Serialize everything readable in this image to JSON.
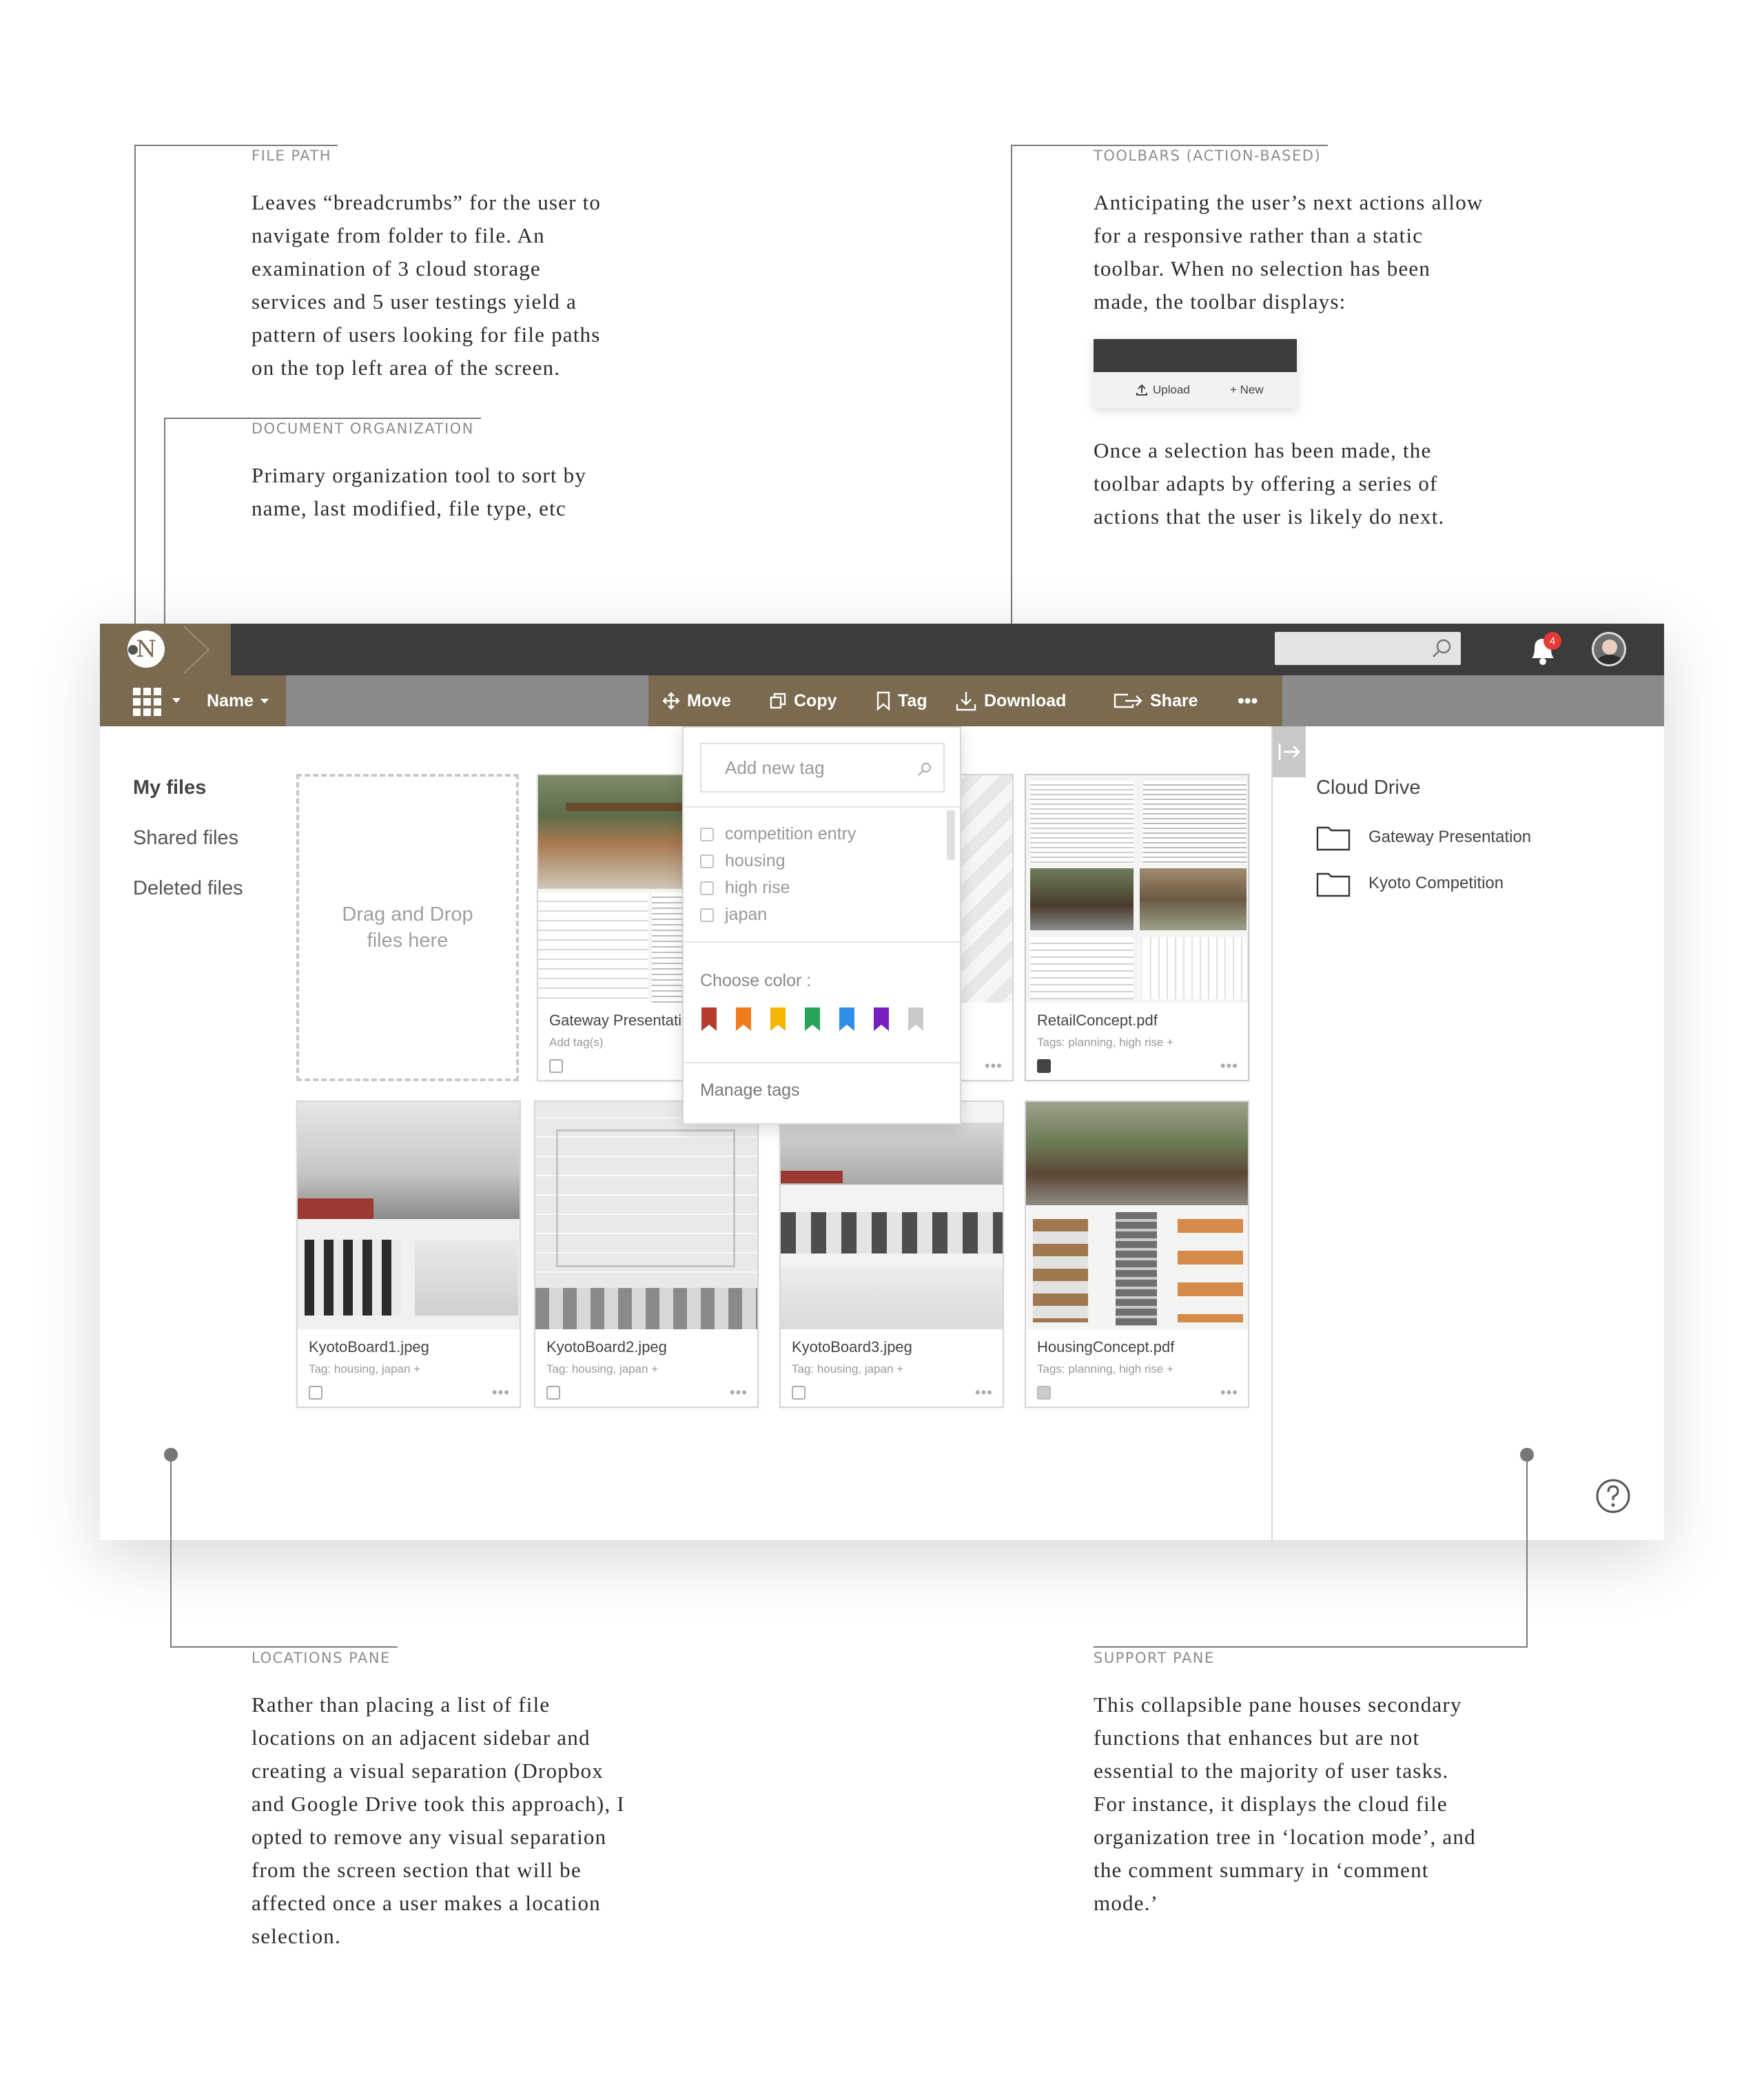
{
  "annotations": {
    "file_path": {
      "label": "FILE PATH",
      "lines": [
        "Leaves “breadcrumbs” for the user to",
        "navigate from folder to file. An",
        "examination of 3 cloud storage",
        "services and 5 user testings yield a",
        "pattern of users looking for file paths",
        "on the top left area of the screen."
      ]
    },
    "document_org": {
      "label": "DOCUMENT ORGANIZATION",
      "lines": [
        "Primary organization tool to sort by",
        "name, last modified, file type, etc"
      ]
    },
    "toolbars": {
      "label": "TOOLBARS (ACTION-BASED)",
      "lines_top": [
        "Anticipating the user’s next actions allow",
        "for a responsive rather than a static",
        "toolbar.  When no selection has been",
        "made, the toolbar displays:"
      ],
      "mini_upload": "Upload",
      "mini_new": "+ New",
      "lines_bottom": [
        "Once a selection has been made, the",
        "toolbar adapts by offering a series of",
        "actions that the user is likely do next."
      ]
    },
    "locations": {
      "label": "LOCATIONS PANE",
      "lines": [
        "Rather than placing a list of file",
        "locations on an adjacent sidebar and",
        "creating a visual separation (Dropbox",
        "and Google Drive took this approach), I",
        "opted to remove any visual separation",
        "from the screen section that will be",
        "affected once a user makes a location",
        "selection."
      ]
    },
    "support": {
      "label": "SUPPORT PANE",
      "lines": [
        "This collapsible pane houses secondary",
        "functions that enhances but are not",
        "essential to the majority of user tasks.",
        "For instance, it displays the cloud file",
        "organization tree in ‘location mode’, and",
        "the comment summary in ‘comment",
        "mode.’"
      ]
    }
  },
  "app": {
    "logo_letter": "N",
    "notification_count": "4",
    "sort_label": "Name",
    "toolbar": {
      "move": "Move",
      "copy": "Copy",
      "tag": "Tag",
      "download": "Download",
      "share": "Share",
      "more": "•••"
    },
    "nav": [
      "My files",
      "Shared files",
      "Deleted files"
    ],
    "dropzone": [
      "Drag and Drop",
      "files here"
    ],
    "files": [
      {
        "name": "Gateway Presentation",
        "tags": "Add tag(s)",
        "checked": "no"
      },
      {
        "name": "",
        "tags": "",
        "checked": "no"
      },
      {
        "name": "RetailConcept.pdf",
        "tags": "Tags: planning, high rise +",
        "checked": "yes"
      },
      {
        "name": "KyotoBoard1.jpeg",
        "tags": "Tag: housing, japan +",
        "checked": "no"
      },
      {
        "name": "KyotoBoard2.jpeg",
        "tags": "Tag: housing, japan +",
        "checked": "no"
      },
      {
        "name": "KyotoBoard3.jpeg",
        "tags": "Tag: housing, japan +",
        "checked": "no"
      },
      {
        "name": "HousingConcept.pdf",
        "tags": "Tags: planning, high rise +",
        "checked": "dim"
      }
    ],
    "tag_dropdown": {
      "placeholder": "Add new tag",
      "options": [
        "competition entry",
        "housing",
        "high rise",
        "japan"
      ],
      "choose_color": "Choose color :",
      "colors": [
        "#b93a2e",
        "#f07c1e",
        "#f4b400",
        "#27a35a",
        "#2f8ee6",
        "#7a1fbf",
        "#c9c9c9"
      ],
      "manage": "Manage tags"
    },
    "support_pane": {
      "title": "Cloud Drive",
      "folders": [
        "Gateway Presentation",
        "Kyoto Competition"
      ]
    },
    "accent_color": "#7a6a4f"
  }
}
